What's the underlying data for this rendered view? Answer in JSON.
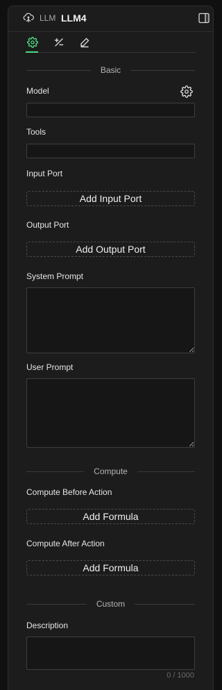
{
  "header": {
    "node_type": "LLM",
    "node_name": "LLM4"
  },
  "tabs": [
    {
      "name": "settings",
      "icon": "gear-icon",
      "active": true
    },
    {
      "name": "formula",
      "icon": "plus-minus-icon",
      "active": false
    },
    {
      "name": "edit",
      "icon": "pencil-icon",
      "active": false
    }
  ],
  "colors": {
    "accent": "#4ade80",
    "panel_bg": "#1c1c1c",
    "input_bg": "#161616"
  },
  "basic": {
    "section_title": "Basic",
    "model_label": "Model",
    "model_value": "",
    "tools_label": "Tools",
    "tools_value": "",
    "input_port_label": "Input Port",
    "add_input_port": "Add Input Port",
    "output_port_label": "Output Port",
    "add_output_port": "Add Output Port",
    "system_prompt_label": "System Prompt",
    "system_prompt_value": "",
    "user_prompt_label": "User Prompt",
    "user_prompt_value": ""
  },
  "compute": {
    "section_title": "Compute",
    "before_label": "Compute Before Action",
    "before_button": "Add Formula",
    "after_label": "Compute After Action",
    "after_button": "Add Formula"
  },
  "custom": {
    "section_title": "Custom",
    "description_label": "Description",
    "description_value": "",
    "description_counter": "0 / 1000"
  }
}
